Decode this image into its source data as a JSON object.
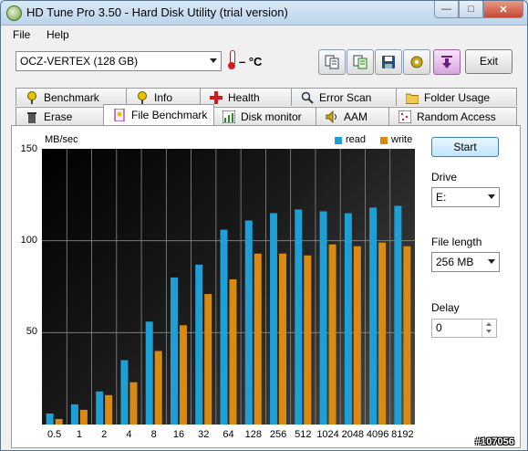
{
  "window": {
    "title": "HD Tune Pro 3.50 - Hard Disk Utility (trial version)"
  },
  "menu": {
    "file": "File",
    "help": "Help"
  },
  "toolbar": {
    "drive": "OCZ-VERTEX (128 GB)",
    "temperature": "– °C",
    "exit_label": "Exit"
  },
  "tabs_top": [
    "Benchmark",
    "Info",
    "Health",
    "Error Scan",
    "Folder Usage"
  ],
  "tabs_bottom": [
    "Erase",
    "File Benchmark",
    "Disk monitor",
    "AAM",
    "Random Access"
  ],
  "side": {
    "start_label": "Start",
    "drive_label": "Drive",
    "drive_value": "E:",
    "file_length_label": "File length",
    "file_length_value": "256 MB",
    "delay_label": "Delay",
    "delay_value": "0"
  },
  "watermark": "#107056",
  "colors": {
    "read": "#1e9fd6",
    "write": "#d98a12",
    "start_button_border": "#3c7fb1"
  },
  "chart_data": {
    "type": "bar",
    "ylabel": "MB/sec",
    "ylim": [
      0,
      150
    ],
    "yticks": [
      "150",
      "100",
      "50"
    ],
    "categories": [
      "0.5",
      "1",
      "2",
      "4",
      "8",
      "16",
      "32",
      "64",
      "128",
      "256",
      "512",
      "1024",
      "2048",
      "4096",
      "8192"
    ],
    "series": [
      {
        "name": "read",
        "values": [
          6,
          11,
          18,
          35,
          56,
          80,
          87,
          106,
          111,
          115,
          117,
          116,
          115,
          118,
          119
        ]
      },
      {
        "name": "write",
        "values": [
          3,
          8,
          16,
          23,
          40,
          54,
          71,
          79,
          93,
          93,
          92,
          98,
          97,
          99,
          97
        ]
      }
    ],
    "grid": true,
    "legend": "top-right"
  }
}
